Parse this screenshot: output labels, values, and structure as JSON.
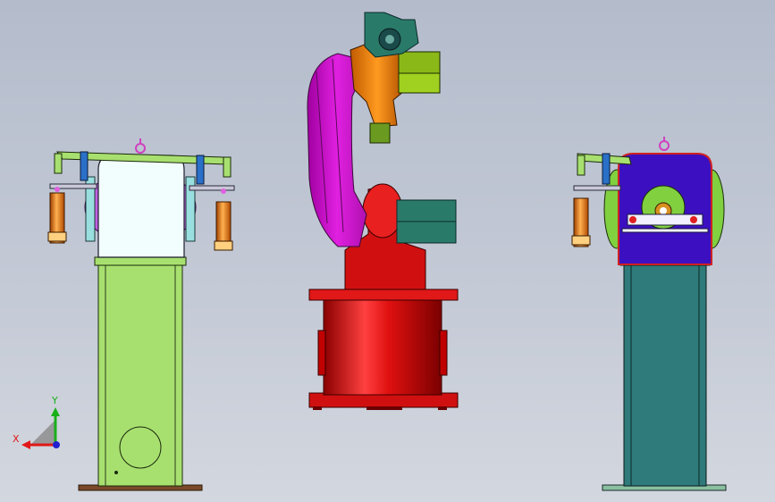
{
  "viewport": {
    "background_top": "#b4bccc",
    "background_bottom": "#d3d7df"
  },
  "triad": {
    "x_label": "X",
    "y_label": "Y",
    "x_color": "#e01818",
    "y_color": "#18b018",
    "z_color": "#2020d0"
  },
  "colors": {
    "robot_base": "#e01010",
    "robot_arm": "#d010d0",
    "robot_wrist": "#f08010",
    "robot_tool": "#80b010",
    "motor_teal": "#2a7a6a",
    "stand_green": "#a8e070",
    "stand_teal": "#2f7a7a",
    "fixture_blue": "#3c10c0",
    "cylinder_orange": "#e07a18"
  }
}
